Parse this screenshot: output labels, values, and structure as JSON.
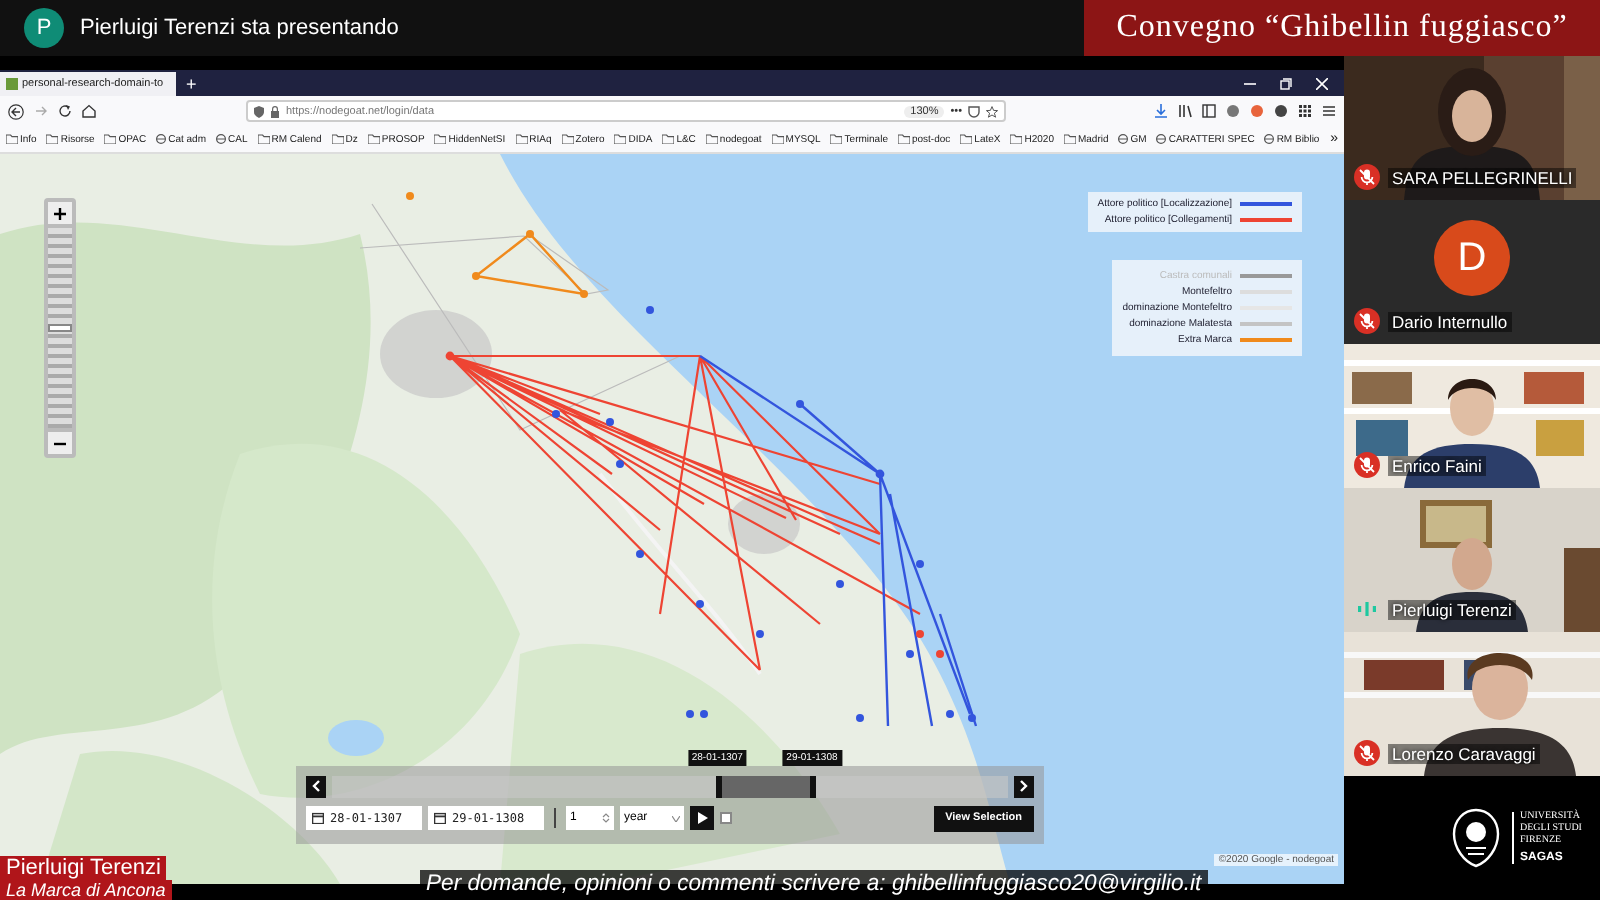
{
  "meeting": {
    "presenter_initial": "P",
    "presenter_text": "Pierluigi Terenzi sta presentando",
    "banner": "Convegno “Ghibellin fuggiasco”"
  },
  "browser": {
    "tabs": [
      {
        "label": "personal-research-domain-to",
        "selected": true
      }
    ],
    "new_tab": "+",
    "url": "https://nodegoat.net/login/data",
    "zoom": "130%",
    "more": "•••",
    "bookmarks": [
      {
        "label": "Info",
        "kind": "folder"
      },
      {
        "label": "Risorse",
        "kind": "folder"
      },
      {
        "label": "OPAC",
        "kind": "folder"
      },
      {
        "label": "Cat adm",
        "kind": "site"
      },
      {
        "label": "CAL",
        "kind": "site"
      },
      {
        "label": "RM Calend",
        "kind": "folder"
      },
      {
        "label": "Dz",
        "kind": "folder"
      },
      {
        "label": "PROSOP",
        "kind": "folder"
      },
      {
        "label": "HiddenNetSI",
        "kind": "folder"
      },
      {
        "label": "RIAq",
        "kind": "folder"
      },
      {
        "label": "Zotero",
        "kind": "folder"
      },
      {
        "label": "DIDA",
        "kind": "folder"
      },
      {
        "label": "L&C",
        "kind": "folder"
      },
      {
        "label": "nodegoat",
        "kind": "folder"
      },
      {
        "label": "MYSQL",
        "kind": "folder"
      },
      {
        "label": "Terminale",
        "kind": "folder"
      },
      {
        "label": "post-doc",
        "kind": "folder"
      },
      {
        "label": "LateX",
        "kind": "folder"
      },
      {
        "label": "H2020",
        "kind": "folder"
      },
      {
        "label": "Madrid",
        "kind": "folder"
      },
      {
        "label": "GM",
        "kind": "site"
      },
      {
        "label": "CARATTERI SPEC",
        "kind": "site"
      },
      {
        "label": "RM Biblio",
        "kind": "site"
      }
    ],
    "bookmarks_more": "»"
  },
  "map": {
    "zoom_slider": {
      "level": 0.5
    },
    "legend_primary": [
      {
        "label": "Attore politico [Localizzazione]",
        "color": "#3355dd"
      },
      {
        "label": "Attore politico [Collegamenti]",
        "color": "#ee4433"
      }
    ],
    "legend_secondary": [
      {
        "label": "Castra comunali",
        "color": "#999999",
        "dimmed": true
      },
      {
        "label": "Montefeltro",
        "color": "#dddddd",
        "dimmed": false
      },
      {
        "label": "dominazione Montefeltro",
        "color": "#e6e6e6",
        "dimmed": false
      },
      {
        "label": "dominazione Malatesta",
        "color": "#c4c4c4",
        "dimmed": false
      },
      {
        "label": "Extra Marca",
        "color": "#f08a1c",
        "dimmed": false
      }
    ],
    "timeline": {
      "handles": [
        {
          "label": "28-01-1307",
          "level": 0.57
        },
        {
          "label": "29-01-1308",
          "level": 0.71
        }
      ],
      "start_date": "28-01-1307",
      "end_date": "29-01-1308",
      "step": "1",
      "unit": "year",
      "loop_checked": false,
      "button": "View Selection"
    },
    "attribution": "©2020 Google - nodegoat"
  },
  "participants": [
    {
      "name": "SARA PELLEGRINELLI",
      "kind": "video",
      "muted": true
    },
    {
      "name": "Dario Internullo",
      "kind": "avatar",
      "initial": "D",
      "muted": true
    },
    {
      "name": "Enrico Faini",
      "kind": "video",
      "muted": true
    },
    {
      "name": "Pierluigi Terenzi",
      "kind": "video",
      "muted": false
    },
    {
      "name": "Lorenzo Caravaggi",
      "kind": "video",
      "muted": true
    }
  ],
  "lower_third": {
    "name": "Pierluigi Terenzi",
    "subtitle": "La Marca di Ancona"
  },
  "caption": "Per domande, opinioni o commenti scrivere a: ghibellinfuggiasco20@virgilio.it",
  "university": {
    "name": "UNIVERSITÀ DEGLI STUDI FIRENZE",
    "department": "SAGAS"
  }
}
